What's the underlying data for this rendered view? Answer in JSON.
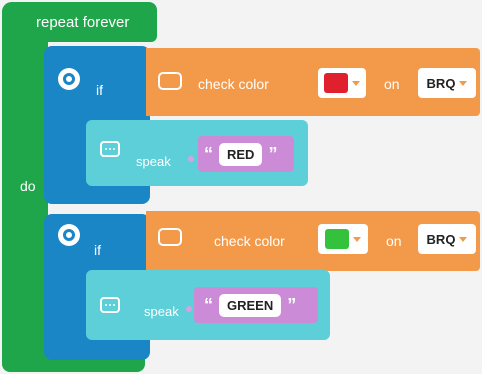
{
  "repeat": {
    "title": "repeat forever",
    "do_label": "do"
  },
  "blocks": [
    {
      "if_label": "if",
      "check_label": "check color",
      "on_label": "on",
      "color": "#e0202c",
      "sensor": "BRQ",
      "speak_label": "speak",
      "text_value": "RED"
    },
    {
      "if_label": "if",
      "check_label": "check color",
      "on_label": "on",
      "color": "#34c23d",
      "sensor": "BRQ",
      "speak_label": "speak",
      "text_value": "GREEN"
    }
  ],
  "quotes": {
    "open": "“",
    "close": "”"
  },
  "colors": {
    "repeat_green": "#1fa64a",
    "if_blue": "#1b86c6",
    "sensor_orange": "#f39a4a",
    "speak_teal": "#5ccfd8",
    "text_purple": "#cc8bd6"
  },
  "icons": {
    "if": "gear-icon",
    "sensor": "color-sensor-icon",
    "speak": "chat-bubble-icon",
    "dropdown": "chevron-down-icon"
  }
}
